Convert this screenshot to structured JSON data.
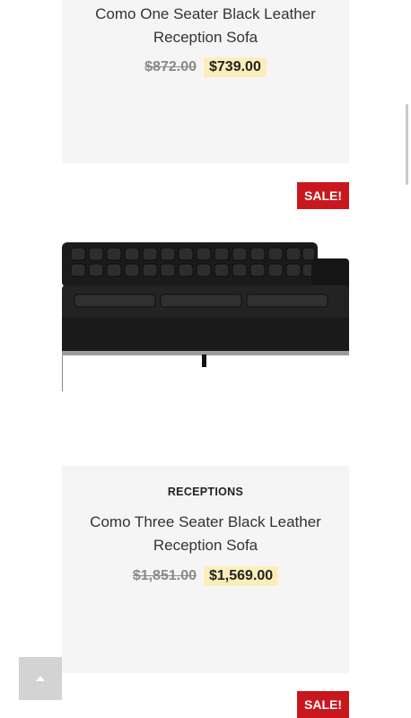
{
  "products": [
    {
      "title_line1": "Como One Seater Black Leather",
      "title_line2": "Reception Sofa",
      "old_price": "$872.00",
      "new_price": "$739.00"
    },
    {
      "sale_badge": "SALE!",
      "category": "RECEPTIONS",
      "title_line1": "Como Three Seater Black Leather",
      "title_line2": "Reception Sofa",
      "old_price": "$1,851.00",
      "new_price": "$1,569.00"
    },
    {
      "sale_badge": "SALE!"
    }
  ],
  "icons": {
    "back_to_top": "chevron-up-icon"
  },
  "colors": {
    "sale_badge": "#c8181e",
    "price_highlight": "#fbeebb",
    "card_background": "#f5f5f5"
  }
}
